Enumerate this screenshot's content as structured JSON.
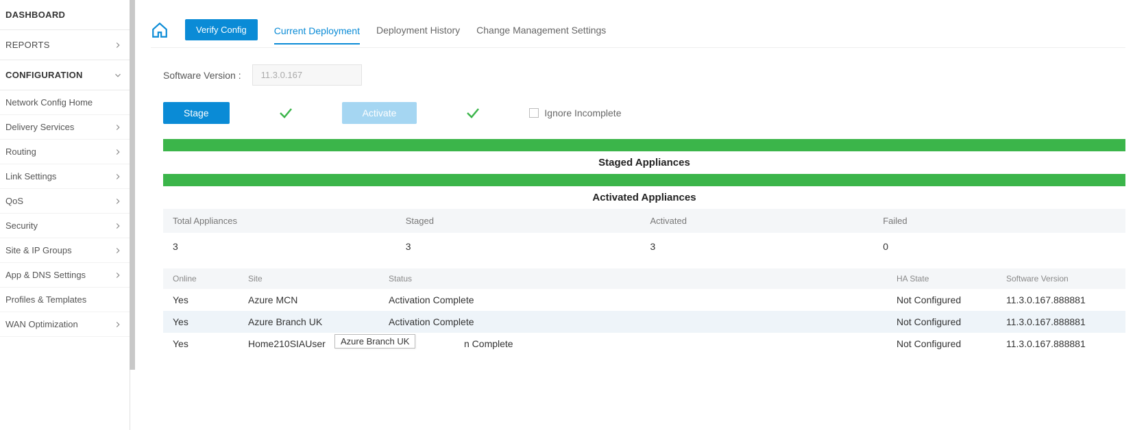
{
  "sidebar": {
    "dashboard": "DASHBOARD",
    "reports": "REPORTS",
    "configuration": "CONFIGURATION",
    "items": [
      "Network Config Home",
      "Delivery Services",
      "Routing",
      "Link Settings",
      "QoS",
      "Security",
      "Site & IP Groups",
      "App & DNS Settings",
      "Profiles & Templates",
      "WAN Optimization"
    ]
  },
  "tabs": {
    "verify": "Verify Config",
    "current": "Current Deployment",
    "history": "Deployment History",
    "settings": "Change Management Settings"
  },
  "software": {
    "label": "Software Version :",
    "value": "11.3.0.167"
  },
  "actions": {
    "stage": "Stage",
    "activate": "Activate",
    "ignore": "Ignore Incomplete"
  },
  "sections": {
    "staged": "Staged Appliances",
    "activated": "Activated Appliances"
  },
  "summary": {
    "headers": {
      "total": "Total Appliances",
      "staged": "Staged",
      "activated": "Activated",
      "failed": "Failed"
    },
    "values": {
      "total": "3",
      "staged": "3",
      "activated": "3",
      "failed": "0"
    }
  },
  "table": {
    "headers": {
      "online": "Online",
      "site": "Site",
      "status": "Status",
      "ha": "HA State",
      "sv": "Software Version"
    },
    "rows": [
      {
        "online": "Yes",
        "site": "Azure MCN",
        "status": "Activation Complete",
        "ha": "Not Configured",
        "sv": "11.3.0.167.888881"
      },
      {
        "online": "Yes",
        "site": "Azure Branch UK",
        "status": "Activation Complete",
        "ha": "Not Configured",
        "sv": "11.3.0.167.888881"
      },
      {
        "online": "Yes",
        "site": "Home210SIAUser",
        "status": "n Complete",
        "ha": "Not Configured",
        "sv": "11.3.0.167.888881"
      }
    ]
  },
  "tooltip": "Azure Branch UK"
}
